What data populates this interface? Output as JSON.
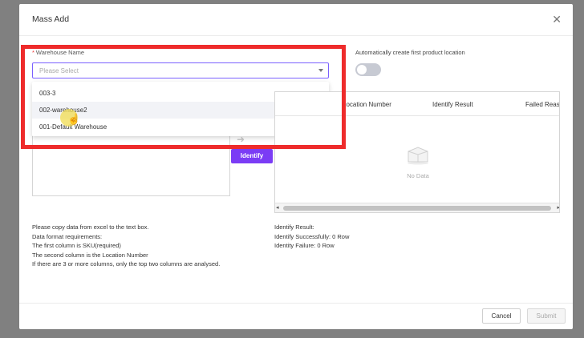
{
  "modal": {
    "title": "Mass Add",
    "close_icon": "close-icon"
  },
  "form": {
    "required_mark": "*",
    "warehouse_label": "Warehouse Name",
    "warehouse_placeholder": "Please Select",
    "warehouse_options": [
      {
        "label": "003-3"
      },
      {
        "label": "002-warehouse2"
      },
      {
        "label": "001-Default Warehouse"
      }
    ],
    "auto_create_label": "Automatically create first product location",
    "auto_create_enabled": false
  },
  "identify_button": "Identify",
  "result_table": {
    "columns": [
      "Location Number",
      "Identify Result",
      "Failed Reason"
    ],
    "empty_text": "No Data"
  },
  "instructions": {
    "lines": [
      "Please copy data from excel to the text box.",
      "Data format requirements:",
      "The first column is SKU(required)",
      "The second column is the Location Number",
      " If there are 3 or more columns, only the top two columns are analysed."
    ]
  },
  "identify_summary": {
    "title": "Identify Result:",
    "success": "Identify Successfully: 0 Row",
    "failure": "Identity Failure: 0 Row"
  },
  "footer": {
    "cancel": "Cancel",
    "submit": "Submit"
  },
  "colors": {
    "accent": "#7b3cf5",
    "highlight": "#ee2b2b"
  }
}
